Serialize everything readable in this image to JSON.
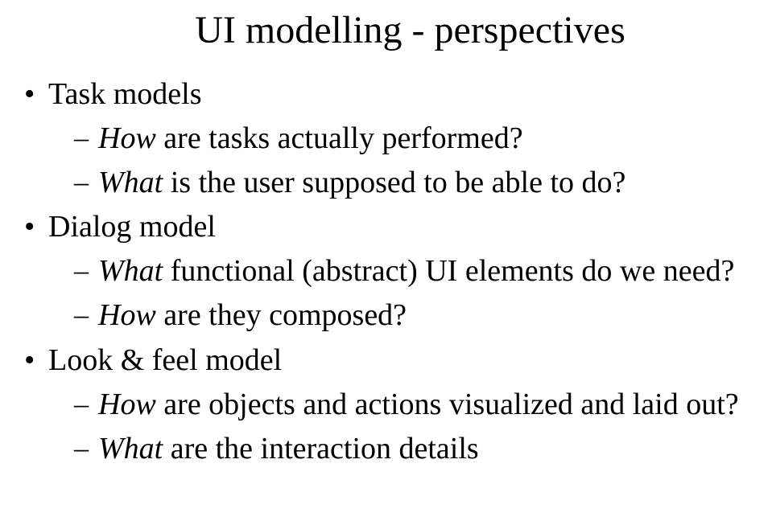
{
  "slide": {
    "title": "UI modelling - perspectives",
    "sections": [
      {
        "heading": "Task models",
        "items": [
          {
            "italic_part": "How",
            "rest": " are tasks actually performed?"
          },
          {
            "italic_part": "What",
            "rest": " is the user supposed to be able to do?"
          }
        ]
      },
      {
        "heading": "Dialog model",
        "items": [
          {
            "italic_part": "What",
            "rest": " functional (abstract) UI elements do we need?"
          },
          {
            "italic_part": "How",
            "rest": " are they composed?"
          }
        ]
      },
      {
        "heading": "Look & feel model",
        "items": [
          {
            "italic_part": "How",
            "rest": " are objects and actions visualized and laid out?"
          },
          {
            "italic_part": "What",
            "rest": " are the interaction details"
          }
        ]
      }
    ]
  }
}
